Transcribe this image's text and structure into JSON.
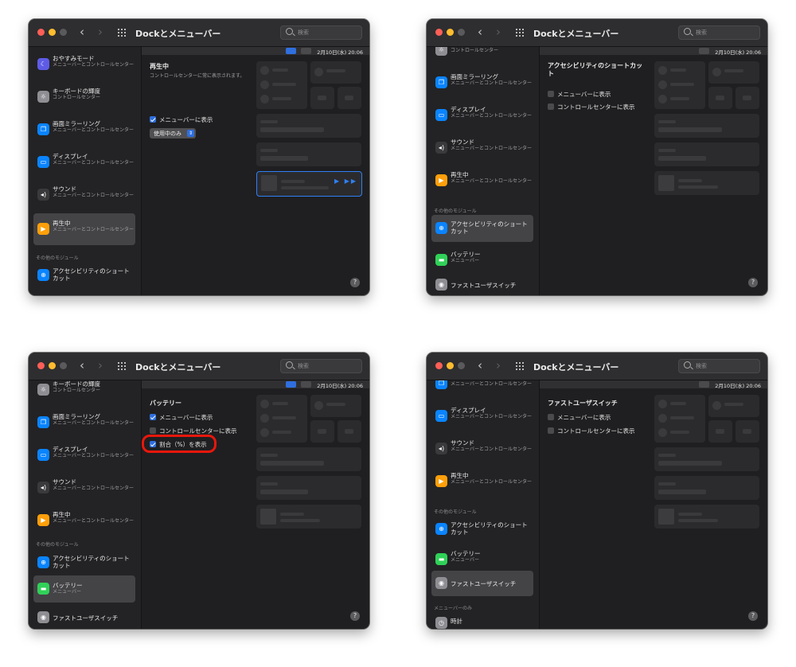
{
  "windows": [
    {
      "title": "Dockとメニューバー",
      "search_placeholder": "検索",
      "menubar_date": "2月10日(水) 20:06",
      "sidebar": {
        "items": [
          {
            "title": "おやすみモード",
            "sub": "メニューバーとコントロールセンター",
            "icon": "moon-icon",
            "color": "#5e5ce6"
          },
          {
            "title": "キーボードの輝度",
            "sub": "コントロールセンター",
            "icon": "keyboard-brightness-icon",
            "color": "#8e8e93"
          },
          {
            "title": "画面ミラーリング",
            "sub": "メニューバーとコントロールセンター",
            "icon": "screen-mirroring-icon",
            "color": "#0a84ff"
          },
          {
            "title": "ディスプレイ",
            "sub": "メニューバーとコントロールセンター",
            "icon": "display-icon",
            "color": "#0a84ff"
          },
          {
            "title": "サウンド",
            "sub": "メニューバーとコントロールセンター",
            "icon": "speaker-icon",
            "color": "#3a3a3c"
          },
          {
            "title": "再生中",
            "sub": "メニューバーとコントロールセンター",
            "icon": "play-icon",
            "color": "#ff9f0a"
          }
        ],
        "section_other": "その他のモジュール",
        "other_items": [
          {
            "title": "アクセシビリティのショートカット",
            "icon": "accessibility-icon",
            "color": "#0a84ff"
          }
        ]
      },
      "content": {
        "title": "再生中",
        "description": "コントロールセンターに常に表示されます。",
        "checkboxes": [
          {
            "label": "メニューバーに表示",
            "checked": true
          }
        ],
        "popup_label": "使用中のみ"
      }
    },
    {
      "title": "Dockとメニューバー",
      "search_placeholder": "検索",
      "menubar_date": "2月10日(水) 20:06",
      "sidebar": {
        "items": [
          {
            "title": "",
            "sub": "コントロールセンター",
            "icon": "keyboard-brightness-icon",
            "color": "#8e8e93"
          },
          {
            "title": "画面ミラーリング",
            "sub": "メニューバーとコントロールセンター",
            "icon": "screen-mirroring-icon",
            "color": "#0a84ff"
          },
          {
            "title": "ディスプレイ",
            "sub": "メニューバーとコントロールセンター",
            "icon": "display-icon",
            "color": "#0a84ff"
          },
          {
            "title": "サウンド",
            "sub": "メニューバーとコントロールセンター",
            "icon": "speaker-icon",
            "color": "#3a3a3c"
          },
          {
            "title": "再生中",
            "sub": "メニューバーとコントロールセンター",
            "icon": "play-icon",
            "color": "#ff9f0a"
          }
        ],
        "section_other": "その他のモジュール",
        "other_items": [
          {
            "title": "アクセシビリティのショートカット",
            "icon": "accessibility-icon",
            "color": "#0a84ff"
          },
          {
            "title": "バッテリー",
            "sub": "メニューバー",
            "icon": "battery-icon",
            "color": "#30d158"
          },
          {
            "title": "ファストユーザスイッチ",
            "icon": "user-switch-icon",
            "color": "#8e8e93"
          }
        ]
      },
      "content": {
        "title": "アクセシビリティのショートカット",
        "checkboxes": [
          {
            "label": "メニューバーに表示",
            "checked": false
          },
          {
            "label": "コントロールセンターに表示",
            "checked": false
          }
        ]
      }
    },
    {
      "title": "Dockとメニューバー",
      "search_placeholder": "検索",
      "menubar_date": "2月10日(水) 20:06",
      "sidebar": {
        "items": [
          {
            "title": "キーボードの輝度",
            "sub": "コントロールセンター",
            "icon": "keyboard-brightness-icon",
            "color": "#8e8e93"
          },
          {
            "title": "画面ミラーリング",
            "sub": "メニューバーとコントロールセンター",
            "icon": "screen-mirroring-icon",
            "color": "#0a84ff"
          },
          {
            "title": "ディスプレイ",
            "sub": "メニューバーとコントロールセンター",
            "icon": "display-icon",
            "color": "#0a84ff"
          },
          {
            "title": "サウンド",
            "sub": "メニューバーとコントロールセンター",
            "icon": "speaker-icon",
            "color": "#3a3a3c"
          },
          {
            "title": "再生中",
            "sub": "メニューバーとコントロールセンター",
            "icon": "play-icon",
            "color": "#ff9f0a"
          }
        ],
        "section_other": "その他のモジュール",
        "other_items": [
          {
            "title": "アクセシビリティのショートカット",
            "icon": "accessibility-icon",
            "color": "#0a84ff"
          },
          {
            "title": "バッテリー",
            "sub": "メニューバー",
            "icon": "battery-icon",
            "color": "#30d158"
          },
          {
            "title": "ファストユーザスイッチ",
            "icon": "user-switch-icon",
            "color": "#8e8e93"
          }
        ]
      },
      "content": {
        "title": "バッテリー",
        "checkboxes": [
          {
            "label": "メニューバーに表示",
            "checked": true
          },
          {
            "label": "コントロールセンターに表示",
            "checked": false
          },
          {
            "label": "割合（%）を表示",
            "checked": true
          }
        ]
      }
    },
    {
      "title": "Dockとメニューバー",
      "search_placeholder": "検索",
      "menubar_date": "2月10日(水) 20:06",
      "sidebar": {
        "items": [
          {
            "title": "",
            "sub": "メニューバーとコントロールセンター",
            "icon": "screen-mirroring-icon",
            "color": "#0a84ff"
          },
          {
            "title": "ディスプレイ",
            "sub": "メニューバーとコントロールセンター",
            "icon": "display-icon",
            "color": "#0a84ff"
          },
          {
            "title": "サウンド",
            "sub": "メニューバーとコントロールセンター",
            "icon": "speaker-icon",
            "color": "#3a3a3c"
          },
          {
            "title": "再生中",
            "sub": "メニューバーとコントロールセンター",
            "icon": "play-icon",
            "color": "#ff9f0a"
          }
        ],
        "section_other": "その他のモジュール",
        "other_items": [
          {
            "title": "アクセシビリティのショートカット",
            "icon": "accessibility-icon",
            "color": "#0a84ff"
          },
          {
            "title": "バッテリー",
            "sub": "メニューバー",
            "icon": "battery-icon",
            "color": "#30d158"
          },
          {
            "title": "ファストユーザスイッチ",
            "icon": "user-switch-icon",
            "color": "#8e8e93"
          }
        ],
        "section_menubar_only": "メニューバーのみ",
        "menubar_only_items": [
          {
            "title": "時計",
            "icon": "clock-icon",
            "color": "#8e8e93"
          }
        ]
      },
      "content": {
        "title": "ファストユーザスイッチ",
        "checkboxes": [
          {
            "label": "メニューバーに表示",
            "checked": false
          },
          {
            "label": "コントロールセンターに表示",
            "checked": false
          }
        ]
      }
    }
  ],
  "glyphs": {
    "back": "‹",
    "forward": "›",
    "help": "?",
    "popup_arrows": "⇕",
    "np_controls": "▶ ▶▶"
  },
  "accent_color": "#2f6fde",
  "annotation_color": "#e8170c"
}
